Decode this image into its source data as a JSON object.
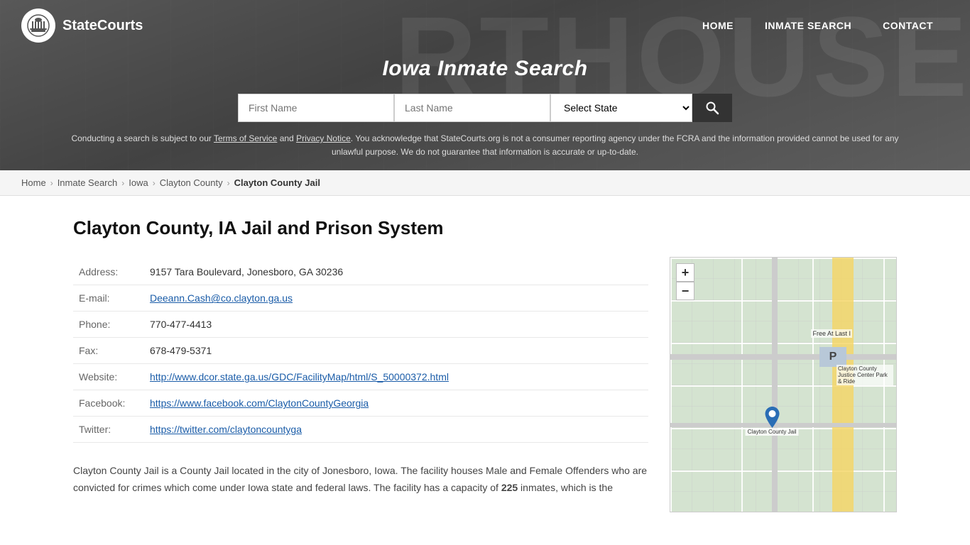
{
  "site": {
    "logo_text": "StateCourts",
    "logo_icon": "🏛"
  },
  "nav": {
    "home_label": "HOME",
    "inmate_search_label": "INMATE SEARCH",
    "contact_label": "CONTACT"
  },
  "hero": {
    "title": "Iowa Inmate Search"
  },
  "search": {
    "first_name_placeholder": "First Name",
    "last_name_placeholder": "Last Name",
    "state_label": "Select State",
    "search_icon": "🔍"
  },
  "disclaimer": {
    "text_before": "Conducting a search is subject to our ",
    "terms_label": "Terms of Service",
    "text_and": " and ",
    "privacy_label": "Privacy Notice",
    "text_after": ". You acknowledge that StateCourts.org is not a consumer reporting agency under the FCRA and the information provided cannot be used for any unlawful purpose. We do not guarantee that information is accurate or up-to-date."
  },
  "breadcrumb": {
    "home": "Home",
    "inmate_search": "Inmate Search",
    "state": "Iowa",
    "county": "Clayton County",
    "current": "Clayton County Jail"
  },
  "facility": {
    "heading": "Clayton County, IA Jail and Prison System",
    "address_label": "Address:",
    "address_value": "9157 Tara Boulevard, Jonesboro, GA 30236",
    "email_label": "E-mail:",
    "email_value": "Deeann.Cash@co.clayton.ga.us",
    "phone_label": "Phone:",
    "phone_value": "770-477-4413",
    "fax_label": "Fax:",
    "fax_value": "678-479-5371",
    "website_label": "Website:",
    "website_value": "http://www.dcor.state.ga.us/GDC/FacilityMap/html/S_50000372.html",
    "facebook_label": "Facebook:",
    "facebook_value": "https://www.facebook.com/ClaytonCountyGeorgia",
    "twitter_label": "Twitter:",
    "twitter_value": "https://twitter.com/claytoncountyga",
    "description": "Clayton County Jail is a County Jail located in the city of Jonesboro, Iowa. The facility houses Male and Female Offenders who are convicted for crimes which come under Iowa state and federal laws. The facility has a capacity of ",
    "capacity": "225",
    "description_after": " inmates, which is the"
  },
  "map": {
    "zoom_in": "+",
    "zoom_out": "−",
    "label_free_at_last": "Free At Last I",
    "label_parking": "P",
    "label_justice": "Clayton County Justice\nCenter Park & Ride",
    "label_jail": "Clayton County Jail"
  }
}
